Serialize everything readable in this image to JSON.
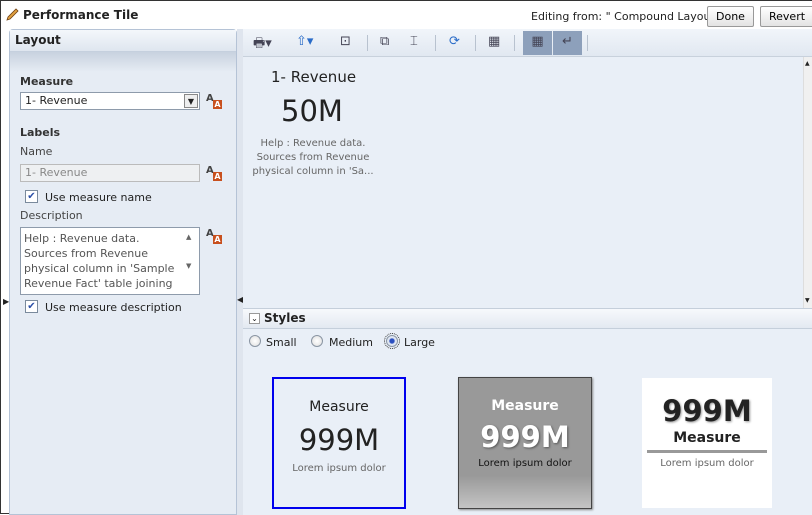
{
  "header": {
    "title": "Performance Tile",
    "editing": "Editing from: \" Compound Layout\"",
    "done": "Done",
    "revert": "Revert"
  },
  "left": {
    "title": "Layout",
    "measure_label": "Measure",
    "measure_value": "1- Revenue",
    "labels_heading": "Labels",
    "name_label": "Name",
    "name_value": "1- Revenue",
    "use_measure_name": "Use measure name",
    "description_label": "Description",
    "description_value": "Help : Revenue data. Sources from Revenue physical column in 'Sample Revenue Fact' table joining to time using Billed",
    "use_measure_description": "Use measure description"
  },
  "preview": {
    "name": "1- Revenue",
    "value": "50M",
    "description": "Help : Revenue data. Sources from Revenue physical column in 'Sa..."
  },
  "styles": {
    "title": "Styles",
    "options": [
      "Small",
      "Medium",
      "Large"
    ],
    "selected": "Large"
  },
  "tiles": [
    {
      "name": "Measure",
      "value": "999M",
      "desc": "Lorem ipsum dolor"
    },
    {
      "name": "Measure",
      "value": "999M",
      "desc": "Lorem ipsum dolor"
    },
    {
      "name": "Measure",
      "value": "999M",
      "desc": "Lorem ipsum dolor"
    }
  ]
}
